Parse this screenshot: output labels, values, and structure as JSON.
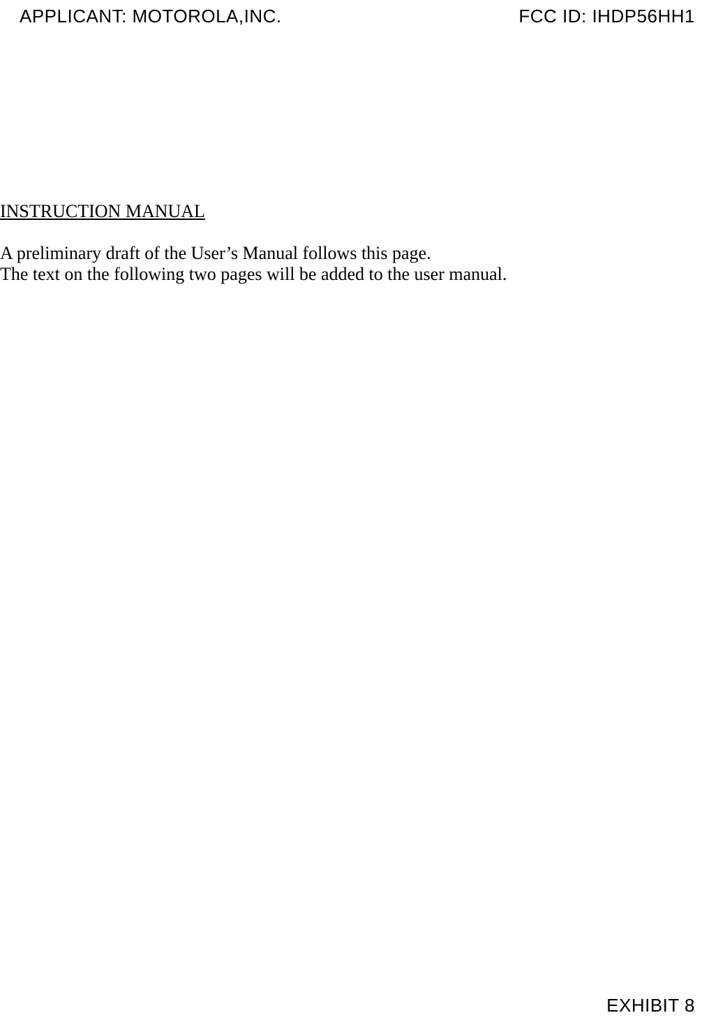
{
  "header": {
    "applicant": "APPLICANT: MOTOROLA,INC.",
    "fcc_id": "FCC ID: IHDP56HH1"
  },
  "body": {
    "title": "INSTRUCTION MANUAL",
    "line1": "A preliminary draft of the User’s Manual follows this page.",
    "line2": "The text on the following two pages will be added to the user manual."
  },
  "footer": {
    "exhibit": "EXHIBIT 8"
  }
}
